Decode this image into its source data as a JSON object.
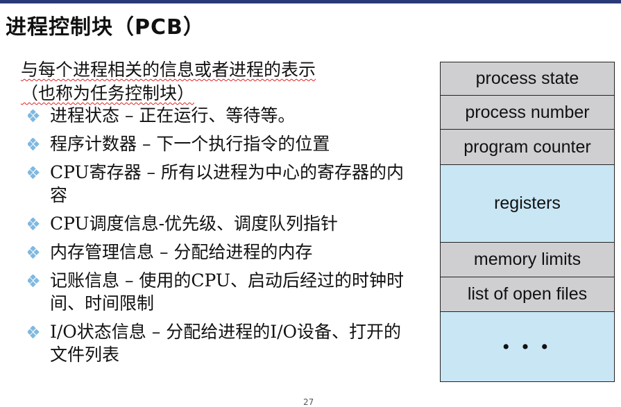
{
  "title": "进程控制块（PCB）",
  "intro": {
    "line1": "与每个进程相关的信息或者进程的表示",
    "line2": "（也称为任务控制块）"
  },
  "bullets": [
    {
      "label": "进程状态 – 正在运行、等待等。"
    },
    {
      "label": "程序计数器 – 下一个执行指令的位置"
    },
    {
      "label": "CPU寄存器 – 所有以进程为中心的寄存器的内容"
    },
    {
      "label": "CPU调度信息-优先级、调度队列指针"
    },
    {
      "label": "内存管理信息 – 分配给进程的内存"
    },
    {
      "label": "记账信息 – 使用的CPU、启动后经过的时钟时间、时间限制"
    },
    {
      "label": "I/O状态信息 – 分配给进程的I/O设备、打开的文件列表"
    }
  ],
  "pcb_table": [
    {
      "label": "process state",
      "color": "#cfcfd2"
    },
    {
      "label": "process number",
      "color": "#cfcfd2"
    },
    {
      "label": "program counter",
      "color": "#cfcfd2"
    },
    {
      "label": "registers",
      "color": "#c9e6f4"
    },
    {
      "label": "memory limits",
      "color": "#cfcfd2"
    },
    {
      "label": "list of open files",
      "color": "#cfcfd2"
    },
    {
      "label": "• • •",
      "color": "#c9e6f4"
    }
  ],
  "page_number": "27",
  "colors": {
    "top_bar": "#2a3a78",
    "bullet": "#7fb8e0"
  }
}
